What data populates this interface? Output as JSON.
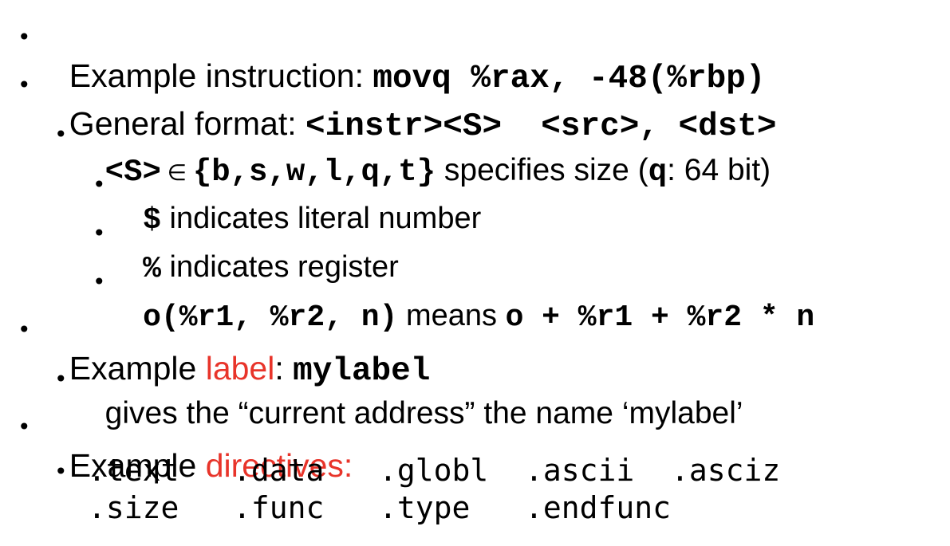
{
  "slide": {
    "bullet_glyph": "•",
    "item1": {
      "text": "Example instruction: ",
      "code": "movq %rax, -48(%rbp)"
    },
    "item2": {
      "text": "General format: ",
      "code": "<instr><S>  <src>, <dst>"
    },
    "item2a": {
      "code1": "<S>",
      "elem": " ∈ ",
      "code2": "{b,s,w,l,q,t}",
      "text1": " specifies size (",
      "code3": "q",
      "text2": ": 64 bit)"
    },
    "item2b": {
      "code": "$",
      "text": " indicates literal number"
    },
    "item2c": {
      "code": "%",
      "text": " indicates register"
    },
    "item2d": {
      "code1": "o(%r1, %r2, n)",
      "text": " means ",
      "code2": "o + %r1 + %r2 * n"
    },
    "item3": {
      "text1": "Example ",
      "red": "label",
      "text2": ": ",
      "code": "mylabel"
    },
    "item3a": {
      "text": "gives the “current address” the name ‘mylabel’"
    },
    "item4": {
      "text1": "Example ",
      "red": "directives:"
    },
    "directives_row1": [
      ".text",
      ".data",
      ".globl",
      ".ascii",
      ".asciz"
    ],
    "directives_row2": [
      ".size",
      ".func",
      ".type",
      ".endfunc"
    ],
    "colors": {
      "text": "#000000",
      "accent": "#e8342a",
      "background": "#ffffff"
    }
  }
}
